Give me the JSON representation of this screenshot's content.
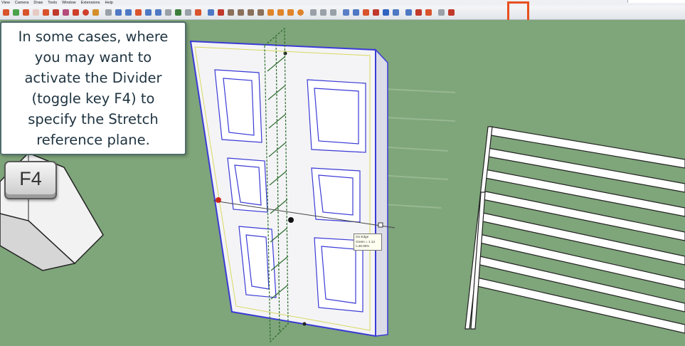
{
  "menu": [
    "View",
    "Camera",
    "Draw",
    "Tools",
    "Window",
    "Extensions",
    "Help"
  ],
  "toolbar": {
    "buttons": [
      {
        "name": "select-icon",
        "color": "#d9532c"
      },
      {
        "name": "component-icon",
        "color": "#4aa34a"
      },
      {
        "name": "paint-bucket-icon",
        "color": "#d9532c"
      },
      {
        "name": "eraser-icon",
        "color": "#e7c9c3"
      },
      {
        "name": "rotate-icon",
        "color": "#d9532c"
      },
      {
        "name": "follow-me-icon",
        "color": "#c0392b"
      },
      {
        "name": "push-pull-icon",
        "color": "#b54b7a"
      },
      {
        "name": "rectangle-icon",
        "color": "#cf3f2c"
      },
      {
        "name": "circle-icon",
        "color": "#cf3f2c"
      },
      {
        "name": "flag-icon",
        "color": "#d48f2a"
      },
      {
        "name": "line-icon",
        "color": "#9aa0a8"
      },
      {
        "name": "arc-icon",
        "color": "#4e78c4"
      },
      {
        "name": "freehand-icon",
        "color": "#4e78c4"
      },
      {
        "name": "move-icon",
        "color": "#d9532c"
      },
      {
        "name": "scale-icon",
        "color": "#4e78c4"
      },
      {
        "name": "offset-icon",
        "color": "#4e78c4"
      },
      {
        "name": "grid-icon",
        "color": "#9aa0a8"
      },
      {
        "name": "text-icon",
        "color": "#3c7d3c"
      },
      {
        "name": "dimension-icon",
        "color": "#9aa0a8"
      },
      {
        "name": "pencil-icon",
        "color": "#d9532c"
      },
      {
        "name": "orbit-icon",
        "color": "#4e78c4"
      },
      {
        "name": "cube-icon",
        "color": "#c0392b"
      },
      {
        "name": "panel-icon",
        "color": "#8a6f5a"
      },
      {
        "name": "panel-icon",
        "color": "#8a6f5a"
      },
      {
        "name": "panel-icon",
        "color": "#8a6f5a"
      },
      {
        "name": "panel-icon",
        "color": "#8a6f5a"
      },
      {
        "name": "orange-square-icon",
        "color": "#e0842a"
      },
      {
        "name": "orange-square-icon",
        "color": "#e0842a"
      },
      {
        "name": "orange-square-icon",
        "color": "#e0842a"
      },
      {
        "name": "orange-circle-icon",
        "color": "#e0842a"
      },
      {
        "name": "lasso-icon",
        "color": "#9aa0a8"
      },
      {
        "name": "dots-icon",
        "color": "#9aa0a8"
      },
      {
        "name": "gear-icon",
        "color": "#9aa0a8"
      },
      {
        "name": "paint-icon",
        "color": "#5a7fc8"
      },
      {
        "name": "arrows-icon",
        "color": "#4e78c4"
      },
      {
        "name": "up-arrows-icon",
        "color": "#d9532c"
      },
      {
        "name": "red-arrows-icon",
        "color": "#c0392b"
      },
      {
        "name": "stretch-divider-icon",
        "color": "#2f64c2"
      },
      {
        "name": "mirror-icon",
        "color": "#4e78c4"
      },
      {
        "name": "undo-icon",
        "color": "#4e78c4"
      },
      {
        "name": "redo-icon",
        "color": "#c0392b"
      },
      {
        "name": "marker-icon",
        "color": "#d9532c"
      },
      {
        "name": "crop-icon",
        "color": "#9aa0a8"
      },
      {
        "name": "stripes-icon",
        "color": "#c0392b"
      }
    ]
  },
  "callout": {
    "lines": [
      "In some cases, where",
      "you may want to",
      "activate the Divider",
      "(toggle key F4) to",
      "specify the Stretch",
      "reference plane."
    ]
  },
  "keycap": {
    "label": "F4"
  },
  "tooltip": {
    "lines": [
      "On Edge",
      "Green = 1.14",
      "l=28.00%"
    ]
  },
  "colors": {
    "ground": "#7fa57a",
    "highlight": "#e8501f",
    "door_edge": "#3b3bd6",
    "divider": "#2b6b2b"
  }
}
